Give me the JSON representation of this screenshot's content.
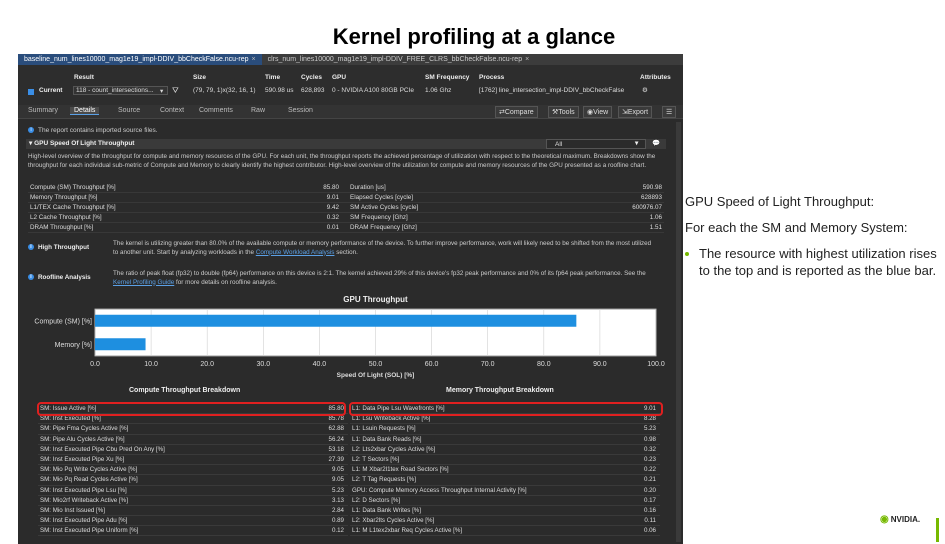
{
  "slide_title": "Kernel profiling at a glance",
  "tabs": [
    {
      "label": "baseline_num_lines10000_mag1e19_impl-DDIV_bbCheckFalse.ncu-rep",
      "close": "×"
    },
    {
      "label": "clrs_num_lines10000_mag1e19_impl-DDIV_FREE_CLRS_bbCheckFalse.ncu-rep",
      "close": "×"
    }
  ],
  "result_header": {
    "labels": {
      "result": "Result",
      "size": "Size",
      "time": "Time",
      "cycles": "Cycles",
      "gpu": "GPU",
      "sm_freq": "SM Frequency",
      "process": "Process",
      "attributes": "Attributes"
    },
    "current_label": "Current",
    "result_value": "118 - count_intersections...",
    "size": "(79, 79, 1)x(32, 16, 1)",
    "time": "590.98 us",
    "cycles": "628,893",
    "gpu": "0 - NVIDIA A100 80GB PCIe",
    "sm_freq": "1.06 Ghz",
    "process": "[1762] line_intersection_impl-DDIV_bbCheckFalse"
  },
  "subtabs": [
    "Summary",
    "Details",
    "Source",
    "Context",
    "Comments",
    "Raw",
    "Session"
  ],
  "active_subtab": "Details",
  "toolbar": {
    "compare": "Compare",
    "tools": "Tools",
    "view": "View",
    "export": "Export"
  },
  "import_note": "The report contains imported source files.",
  "section": {
    "title": "GPU Speed Of Light Throughput",
    "dropdown": "All",
    "description": "High-level overview of the throughput for compute and memory resources of the GPU. For each unit, the throughput reports the achieved percentage of utilization with respect to the theoretical maximum. Breakdowns show the throughput for each individual sub-metric of Compute and Memory to clearly identify the highest contributor. High-level overview of the utilization for compute and memory resources of the GPU presented as a roofline chart."
  },
  "metrics": [
    {
      "name": "Compute (SM) Throughput [%]",
      "value": "85.80",
      "name2": "Duration [us]",
      "value2": "590.98"
    },
    {
      "name": "Memory Throughput [%]",
      "value": "9.01",
      "name2": "Elapsed Cycles [cycle]",
      "value2": "628893"
    },
    {
      "name": "L1/TEX Cache Throughput [%]",
      "value": "9.42",
      "name2": "SM Active Cycles [cycle]",
      "value2": "600976.07"
    },
    {
      "name": "L2 Cache Throughput [%]",
      "value": "0.32",
      "name2": "SM Frequency [Ghz]",
      "value2": "1.06"
    },
    {
      "name": "DRAM Throughput [%]",
      "value": "0.01",
      "name2": "DRAM Frequency [Ghz]",
      "value2": "1.51"
    }
  ],
  "notes": {
    "high_title": "High Throughput",
    "high_text": "The kernel is utilizing greater than 80.0% of the available compute or memory performance of the device. To further improve performance, work will likely need to be shifted from the most utilized to another unit. Start by analyzing workloads in the",
    "high_link": "Compute Workload Analysis",
    "high_tail": "section.",
    "roof_title": "Roofline Analysis",
    "roof_text": "The ratio of peak float (fp32) to double (fp64) performance on this device is 2:1. The kernel achieved 29% of this device's fp32 peak performance and 0% of its fp64 peak performance. See the",
    "roof_link": "Kernel Profiling Guide",
    "roof_tail": "for more details on roofline analysis."
  },
  "chart_data": {
    "type": "bar",
    "orientation": "horizontal",
    "title": "GPU Throughput",
    "xlabel": "Speed Of Light (SOL) [%]",
    "categories": [
      "Compute (SM) [%]",
      "Memory [%]"
    ],
    "values": [
      85.8,
      9.01
    ],
    "xlim": [
      0,
      100
    ],
    "xticks": [
      "0.0",
      "10.0",
      "20.0",
      "30.0",
      "40.0",
      "50.0",
      "60.0",
      "70.0",
      "80.0",
      "90.0",
      "100.0"
    ],
    "bar_color": "#1e8fe0",
    "grid": true
  },
  "compute_breakdown": {
    "title": "Compute Throughput Breakdown",
    "rows": [
      {
        "name": "SM: Issue Active [%]",
        "value": "85.80"
      },
      {
        "name": "SM: Inst Executed [%]",
        "value": "85.78"
      },
      {
        "name": "SM: Pipe Fma Cycles Active [%]",
        "value": "62.88"
      },
      {
        "name": "SM: Pipe Alu Cycles Active [%]",
        "value": "56.24"
      },
      {
        "name": "SM: Inst Executed Pipe Cbu Pred On Any [%]",
        "value": "53.18"
      },
      {
        "name": "SM: Inst Executed Pipe Xu [%]",
        "value": "27.39"
      },
      {
        "name": "SM: Mio Pq Write Cycles Active [%]",
        "value": "9.05"
      },
      {
        "name": "SM: Mio Pq Read Cycles Active [%]",
        "value": "9.05"
      },
      {
        "name": "SM: Inst Executed Pipe Lsu [%]",
        "value": "5.23"
      },
      {
        "name": "SM: Mio2rf Writeback Active [%]",
        "value": "3.13"
      },
      {
        "name": "SM: Mio Inst Issued [%]",
        "value": "2.84"
      },
      {
        "name": "SM: Inst Executed Pipe Adu [%]",
        "value": "0.89"
      },
      {
        "name": "SM: Inst Executed Pipe Uniform [%]",
        "value": "0.12"
      }
    ]
  },
  "memory_breakdown": {
    "title": "Memory Throughput Breakdown",
    "rows": [
      {
        "name": "L1: Data Pipe Lsu Wavefronts [%]",
        "value": "9.01"
      },
      {
        "name": "L1: Lsu Writeback Active [%]",
        "value": "8.28"
      },
      {
        "name": "L1: Lsuin Requests [%]",
        "value": "5.23"
      },
      {
        "name": "L1: Data Bank Reads [%]",
        "value": "0.98"
      },
      {
        "name": "L2: Lts2xbar Cycles Active [%]",
        "value": "0.32"
      },
      {
        "name": "L2: T Sectors [%]",
        "value": "0.23"
      },
      {
        "name": "L1: M Xbar2l1tex Read Sectors [%]",
        "value": "0.22"
      },
      {
        "name": "L2: T Tag Requests [%]",
        "value": "0.21"
      },
      {
        "name": "GPU: Compute Memory Access Throughput Internal Activity [%]",
        "value": "0.20"
      },
      {
        "name": "L2: D Sectors [%]",
        "value": "0.17"
      },
      {
        "name": "L1: Data Bank Writes [%]",
        "value": "0.16"
      },
      {
        "name": "L2: Xbar2lts Cycles Active [%]",
        "value": "0.11"
      },
      {
        "name": "L1: M L1tex2xbar Req Cycles Active [%]",
        "value": "0.06"
      }
    ]
  },
  "side": {
    "line1": "GPU Speed of Light Throughput:",
    "line2": "For each the SM and Memory System:",
    "bullet": "The resource with highest utilization rises to the top and is reported as the blue bar."
  },
  "logo": "NVIDIA."
}
